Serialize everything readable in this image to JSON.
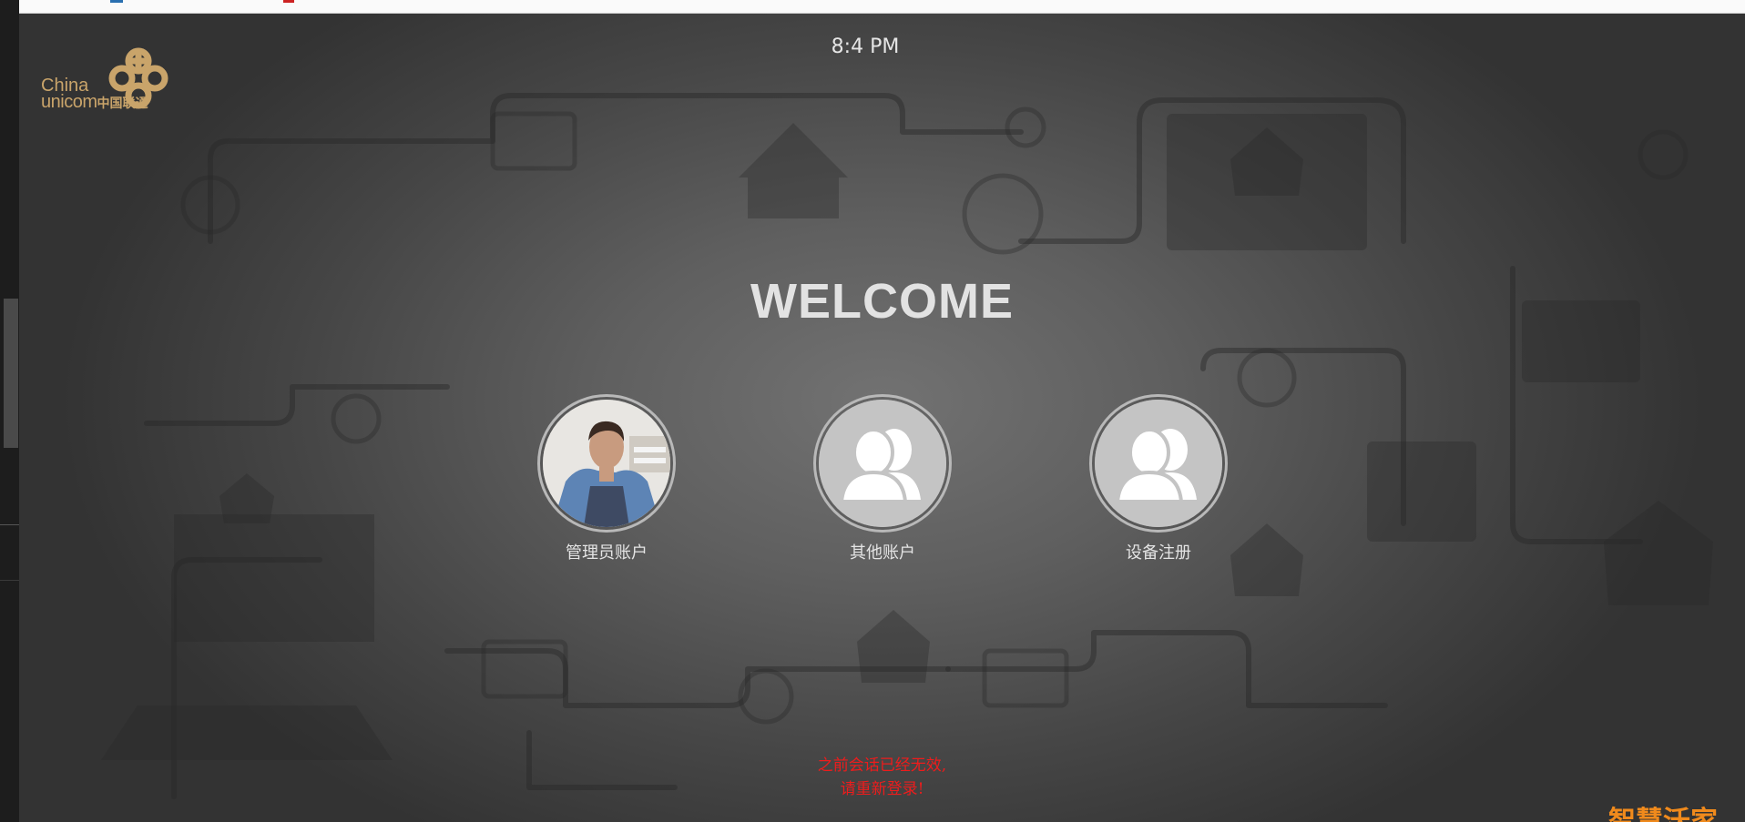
{
  "header": {
    "time": "8:4 PM"
  },
  "logo": {
    "line1": "China",
    "line2_en": "unicom",
    "line2_cn": "中国联通"
  },
  "main": {
    "welcome": "WELCOME",
    "accounts": [
      {
        "label": "管理员账户",
        "icon": "admin-photo-avatar"
      },
      {
        "label": "其他账户",
        "icon": "users-icon"
      },
      {
        "label": "设备注册",
        "icon": "users-icon"
      }
    ]
  },
  "message": {
    "line1": "之前会话已经无效,",
    "line2": "请重新登录!"
  },
  "brand": {
    "text": "智慧沃家"
  },
  "colors": {
    "accent": "#c9a46a",
    "error": "#ee1c1c",
    "brand": "#f08a1c"
  }
}
